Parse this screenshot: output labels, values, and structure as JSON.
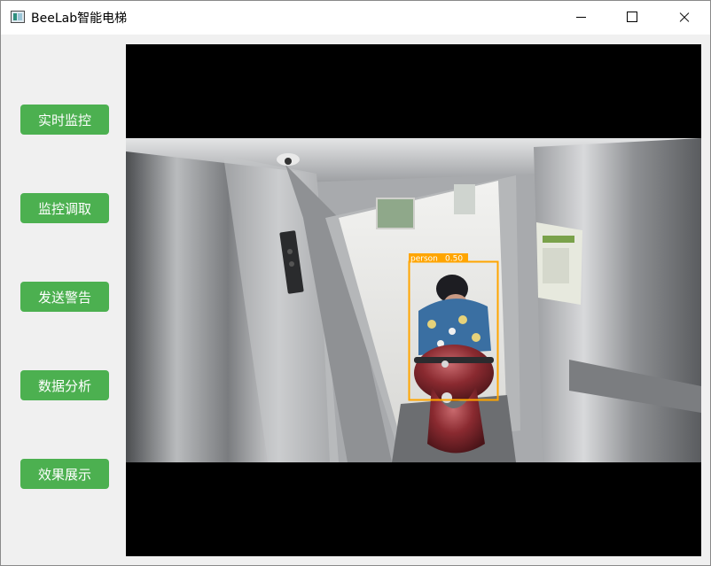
{
  "window": {
    "title": "BeeLab智能电梯"
  },
  "sidebar": {
    "buttons": [
      {
        "label": "实时监控"
      },
      {
        "label": "监控调取"
      },
      {
        "label": "发送警告"
      },
      {
        "label": "数据分析"
      },
      {
        "label": "效果展示"
      }
    ]
  },
  "detection": {
    "label": "person",
    "confidence": "0.50",
    "box_color": "#ffa500"
  },
  "theme": {
    "button_color": "#4cb050",
    "titlebar_color": "#ffffff",
    "background": "#f0f0f0"
  },
  "icons": {
    "app": "app-window-icon",
    "minimize": "minimize-icon",
    "maximize": "maximize-icon",
    "close": "close-icon"
  }
}
